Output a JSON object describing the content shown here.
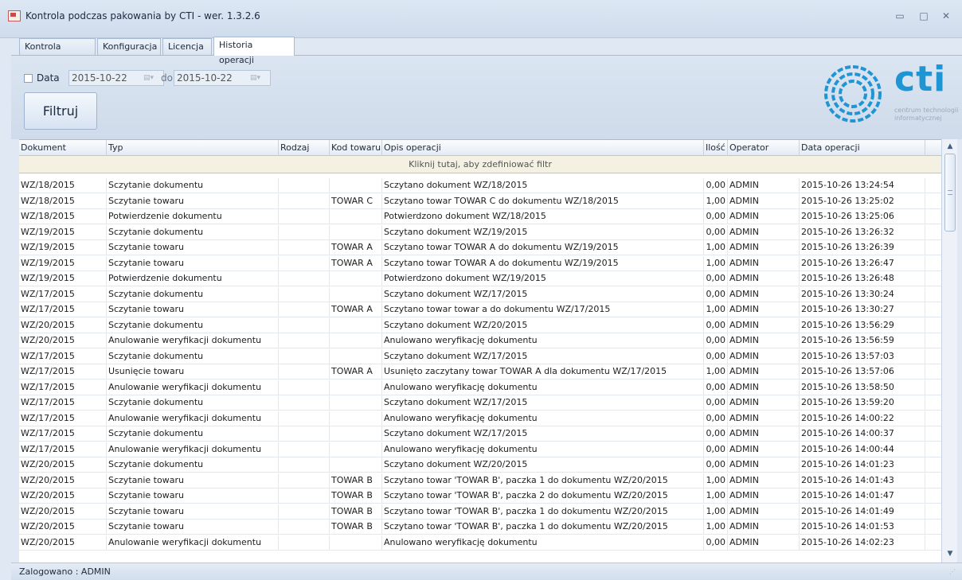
{
  "window": {
    "title": "Kontrola podczas pakowania by CTI -  wer. 1.3.2.6",
    "minimize": "▭",
    "maximize": "□",
    "close": "✕"
  },
  "tabs": [
    {
      "label": "Kontrola wydań"
    },
    {
      "label": "Konfiguracja"
    },
    {
      "label": "Licencja"
    },
    {
      "label": "Historia operacji",
      "active": true
    }
  ],
  "filter": {
    "data_label": "Data",
    "date_from": "2015-10-22",
    "to_label": "do",
    "date_to": "2015-10-22",
    "filter_button": "Filtruj"
  },
  "logo": {
    "word": "cti",
    "subtitle": "centrum technologii informatycznej"
  },
  "grid": {
    "columns": [
      "Dokument",
      "Typ",
      "Rodzaj",
      "Kod towaru",
      "Opis operacji",
      "Ilość",
      "Operator",
      "Data operacji"
    ],
    "filter_hint": "Kliknij tutaj, aby zdefiniować filtr",
    "rows": [
      [
        "WZ/18/2015",
        "Sczytanie dokumentu",
        "",
        "",
        "Sczytano dokument WZ/18/2015",
        "0,00",
        "ADMIN",
        "2015-10-26 13:24:54"
      ],
      [
        "WZ/18/2015",
        "Sczytanie towaru",
        "",
        "TOWAR C",
        "Sczytano towar TOWAR C do dokumentu WZ/18/2015",
        "1,00",
        "ADMIN",
        "2015-10-26 13:25:02"
      ],
      [
        "WZ/18/2015",
        "Potwierdzenie dokumentu",
        "",
        "",
        "Potwierdzono dokument WZ/18/2015",
        "0,00",
        "ADMIN",
        "2015-10-26 13:25:06"
      ],
      [
        "WZ/19/2015",
        "Sczytanie dokumentu",
        "",
        "",
        "Sczytano dokument WZ/19/2015",
        "0,00",
        "ADMIN",
        "2015-10-26 13:26:32"
      ],
      [
        "WZ/19/2015",
        "Sczytanie towaru",
        "",
        "TOWAR A",
        "Sczytano towar TOWAR A do dokumentu WZ/19/2015",
        "1,00",
        "ADMIN",
        "2015-10-26 13:26:39"
      ],
      [
        "WZ/19/2015",
        "Sczytanie towaru",
        "",
        "TOWAR A",
        "Sczytano towar TOWAR A do dokumentu WZ/19/2015",
        "1,00",
        "ADMIN",
        "2015-10-26 13:26:47"
      ],
      [
        "WZ/19/2015",
        "Potwierdzenie dokumentu",
        "",
        "",
        "Potwierdzono dokument WZ/19/2015",
        "0,00",
        "ADMIN",
        "2015-10-26 13:26:48"
      ],
      [
        "WZ/17/2015",
        "Sczytanie dokumentu",
        "",
        "",
        "Sczytano dokument WZ/17/2015",
        "0,00",
        "ADMIN",
        "2015-10-26 13:30:24"
      ],
      [
        "WZ/17/2015",
        "Sczytanie towaru",
        "",
        "TOWAR A",
        "Sczytano towar towar a do dokumentu WZ/17/2015",
        "1,00",
        "ADMIN",
        "2015-10-26 13:30:27"
      ],
      [
        "WZ/20/2015",
        "Sczytanie dokumentu",
        "",
        "",
        "Sczytano dokument WZ/20/2015",
        "0,00",
        "ADMIN",
        "2015-10-26 13:56:29"
      ],
      [
        "WZ/20/2015",
        "Anulowanie weryfikacji dokumentu",
        "",
        "",
        "Anulowano weryfikację dokumentu",
        "0,00",
        "ADMIN",
        "2015-10-26 13:56:59"
      ],
      [
        "WZ/17/2015",
        "Sczytanie dokumentu",
        "",
        "",
        "Sczytano dokument WZ/17/2015",
        "0,00",
        "ADMIN",
        "2015-10-26 13:57:03"
      ],
      [
        "WZ/17/2015",
        "Usunięcie towaru",
        "",
        "TOWAR A",
        "Usunięto zaczytany towar TOWAR A dla dokumentu WZ/17/2015",
        "1,00",
        "ADMIN",
        "2015-10-26 13:57:06"
      ],
      [
        "WZ/17/2015",
        "Anulowanie weryfikacji dokumentu",
        "",
        "",
        "Anulowano weryfikację dokumentu",
        "0,00",
        "ADMIN",
        "2015-10-26 13:58:50"
      ],
      [
        "WZ/17/2015",
        "Sczytanie dokumentu",
        "",
        "",
        "Sczytano dokument WZ/17/2015",
        "0,00",
        "ADMIN",
        "2015-10-26 13:59:20"
      ],
      [
        "WZ/17/2015",
        "Anulowanie weryfikacji dokumentu",
        "",
        "",
        "Anulowano weryfikację dokumentu",
        "0,00",
        "ADMIN",
        "2015-10-26 14:00:22"
      ],
      [
        "WZ/17/2015",
        "Sczytanie dokumentu",
        "",
        "",
        "Sczytano dokument WZ/17/2015",
        "0,00",
        "ADMIN",
        "2015-10-26 14:00:37"
      ],
      [
        "WZ/17/2015",
        "Anulowanie weryfikacji dokumentu",
        "",
        "",
        "Anulowano weryfikację dokumentu",
        "0,00",
        "ADMIN",
        "2015-10-26 14:00:44"
      ],
      [
        "WZ/20/2015",
        "Sczytanie dokumentu",
        "",
        "",
        "Sczytano dokument WZ/20/2015",
        "0,00",
        "ADMIN",
        "2015-10-26 14:01:23"
      ],
      [
        "WZ/20/2015",
        "Sczytanie towaru",
        "",
        "TOWAR B",
        "Sczytano towar 'TOWAR B', paczka 1 do dokumentu WZ/20/2015",
        "1,00",
        "ADMIN",
        "2015-10-26 14:01:43"
      ],
      [
        "WZ/20/2015",
        "Sczytanie towaru",
        "",
        "TOWAR B",
        "Sczytano towar 'TOWAR B', paczka 2 do dokumentu WZ/20/2015",
        "1,00",
        "ADMIN",
        "2015-10-26 14:01:47"
      ],
      [
        "WZ/20/2015",
        "Sczytanie towaru",
        "",
        "TOWAR B",
        "Sczytano towar 'TOWAR B', paczka 1 do dokumentu WZ/20/2015",
        "1,00",
        "ADMIN",
        "2015-10-26 14:01:49"
      ],
      [
        "WZ/20/2015",
        "Sczytanie towaru",
        "",
        "TOWAR B",
        "Sczytano towar 'TOWAR B', paczka 1 do dokumentu WZ/20/2015",
        "1,00",
        "ADMIN",
        "2015-10-26 14:01:53"
      ],
      [
        "WZ/20/2015",
        "Anulowanie weryfikacji dokumentu",
        "",
        "",
        "Anulowano weryfikację dokumentu",
        "0,00",
        "ADMIN",
        "2015-10-26 14:02:23"
      ]
    ]
  },
  "status": {
    "text": "Zalogowano : ADMIN"
  }
}
